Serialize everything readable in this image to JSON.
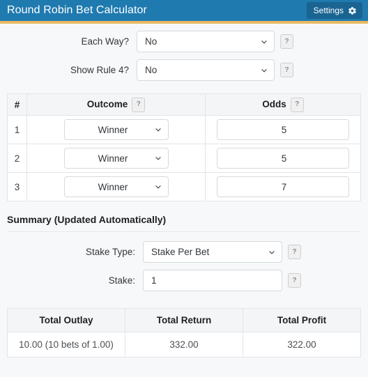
{
  "header": {
    "title": "Round Robin Bet Calculator",
    "settings_label": "Settings",
    "settings_icon": "gear-icon",
    "bg_color": "#1f7ab0",
    "accent_color": "#e8b961",
    "button_color": "#1a6492"
  },
  "options": {
    "each_way": {
      "label": "Each Way?",
      "value": "No",
      "help": "?"
    },
    "show_rule4": {
      "label": "Show Rule 4?",
      "value": "No",
      "help": "?"
    }
  },
  "bets_table": {
    "columns": {
      "number": "#",
      "outcome": "Outcome",
      "odds": "Odds"
    },
    "outcome_help": "?",
    "odds_help": "?",
    "rows": [
      {
        "number": "1",
        "outcome": "Winner",
        "odds": "5"
      },
      {
        "number": "2",
        "outcome": "Winner",
        "odds": "5"
      },
      {
        "number": "3",
        "outcome": "Winner",
        "odds": "7"
      }
    ]
  },
  "summary": {
    "heading": "Summary (Updated Automatically)",
    "stake_type": {
      "label": "Stake Type:",
      "value": "Stake Per Bet",
      "help": "?"
    },
    "stake": {
      "label": "Stake:",
      "value": "1",
      "help": "?"
    }
  },
  "totals": {
    "columns": {
      "outlay": "Total Outlay",
      "return": "Total Return",
      "profit": "Total Profit"
    },
    "values": {
      "outlay": "10.00 (10 bets of 1.00)",
      "return": "332.00",
      "profit": "322.00"
    }
  }
}
